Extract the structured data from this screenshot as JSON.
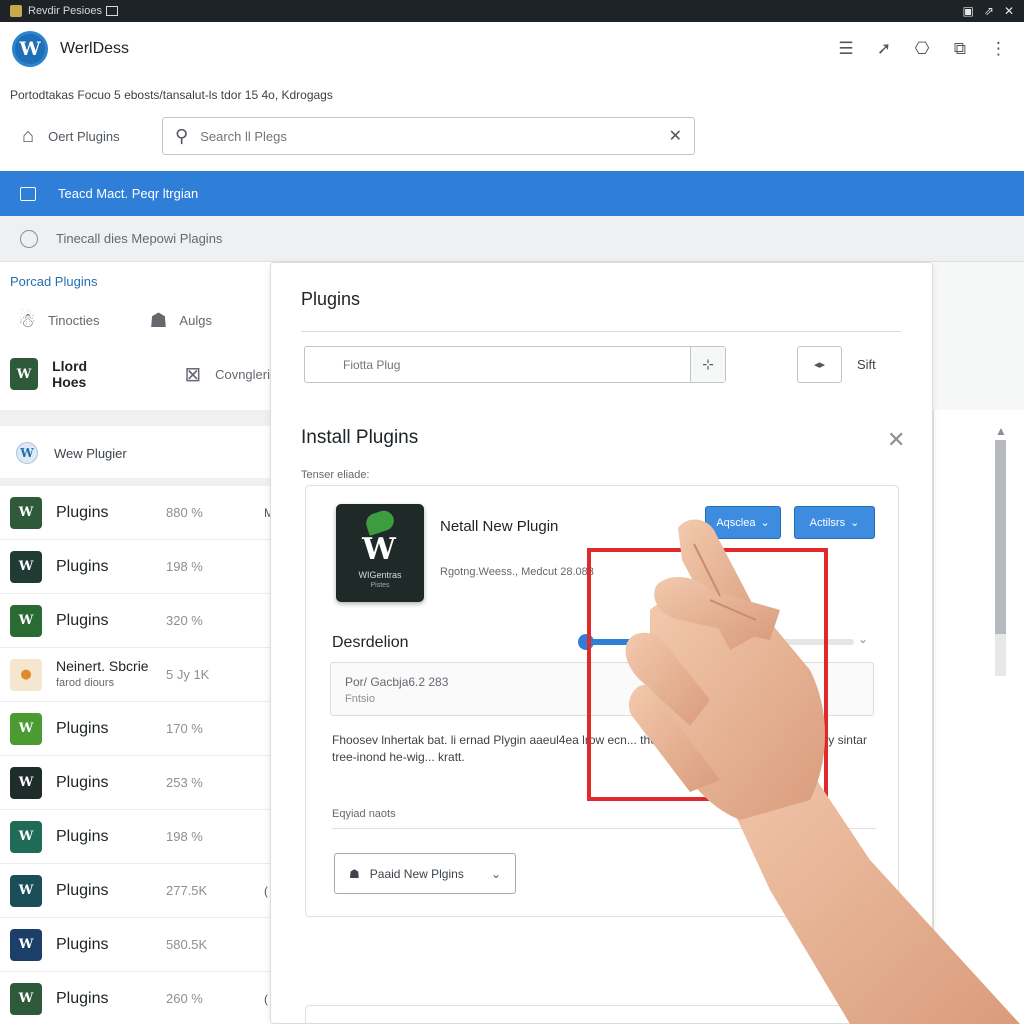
{
  "window": {
    "title": "Revdir Pesioes"
  },
  "header": {
    "brand": "WerlDess"
  },
  "breadcrumb": "Portodtakas Focuo  5 ebosts/tansalut-ls tdor 15  4o, Kdrogags",
  "toolbar": {
    "label": "Oert Plugins",
    "search_placeholder": "Search ll Plegs"
  },
  "bluebar": {
    "label": "Teacd Mact. Peqr ltrgian"
  },
  "graybar": {
    "label": "Tinecall dies Mepowi Plagins"
  },
  "left": {
    "title": "Porcad Plugins",
    "row1": [
      "Tinocties",
      "Aulgs"
    ],
    "row2": [
      "Llord Hoes",
      "Covngleri"
    ],
    "new_label": "Wew Plugier",
    "plugins": [
      {
        "name": "Plugins",
        "value": "880 %",
        "edge": "M",
        "tile": "#2e5a3a",
        "glyph": "W"
      },
      {
        "name": "Plugins",
        "value": "198 %",
        "edge": "",
        "tile": "#1f3b34",
        "glyph": "W"
      },
      {
        "name": "Plugins",
        "value": "320 %",
        "edge": "",
        "tile": "#2a6a33",
        "glyph": "W"
      },
      {
        "name": "Neinert. Sbcrie",
        "sub": "farod diours",
        "value": "5 Jy 1K",
        "edge": "",
        "tile": "#f5e6d0",
        "glyph": "●"
      },
      {
        "name": "Plugins",
        "value": "170 %",
        "edge": "",
        "tile": "#4b9a32",
        "glyph": "W"
      },
      {
        "name": "Plugins",
        "value": "253 %",
        "edge": "",
        "tile": "#1e2c2a",
        "glyph": "W"
      },
      {
        "name": "Plugins",
        "value": "198 %",
        "edge": "",
        "tile": "#1f6b58",
        "glyph": "W"
      },
      {
        "name": "Plugins",
        "value": "277.5K",
        "edge": "(",
        "tile": "#1a4f5a",
        "glyph": "W"
      },
      {
        "name": "Plugins",
        "value": "580.5K",
        "edge": "",
        "tile": "#1c3f6a",
        "glyph": "W"
      },
      {
        "name": "Plugins",
        "value": "260 %",
        "edge": "(",
        "tile": "#2e5a3a",
        "glyph": "W"
      }
    ]
  },
  "card": {
    "title": "Plugins",
    "filter_placeholder": "Fiotta Plug",
    "sort_label": "Sift",
    "install_title": "Install Plugins",
    "install_sub": "Tenser eliade:",
    "plugin_title": "Netall New Plugin",
    "plugin_meta": "Rgotng.Weess., Medcut 28.083",
    "image_caption": "WIGentras",
    "image_caption2": "Pistes",
    "btn_primary": "Aqsclea",
    "btn_secondary": "Actilsrs",
    "description_label": "Desrdelion",
    "progress": 0.4,
    "version_line1": "Por/ Gacbja6.2 283",
    "version_line2": "Fntsio",
    "long_description": "Fhoosev lnhertak bat. li ernad Plygin aaeul4ea lrow ecn... the stouing tinwaliloo oltumn.9 Plagy sintar tree-inond  he-wig... kratt.",
    "requirements_label": "Eqyiad naots",
    "add_button": "Paaid New Plgins"
  },
  "colors": {
    "accent": "#2f7fd8",
    "highlight": "#e0292b",
    "titlebar": "#1d2327"
  },
  "icons": [
    "wordpress-logo-icon",
    "menu-icon",
    "pin-icon",
    "bag-icon",
    "camera-icon",
    "more-icon",
    "home-icon",
    "search-icon",
    "close-icon"
  ]
}
